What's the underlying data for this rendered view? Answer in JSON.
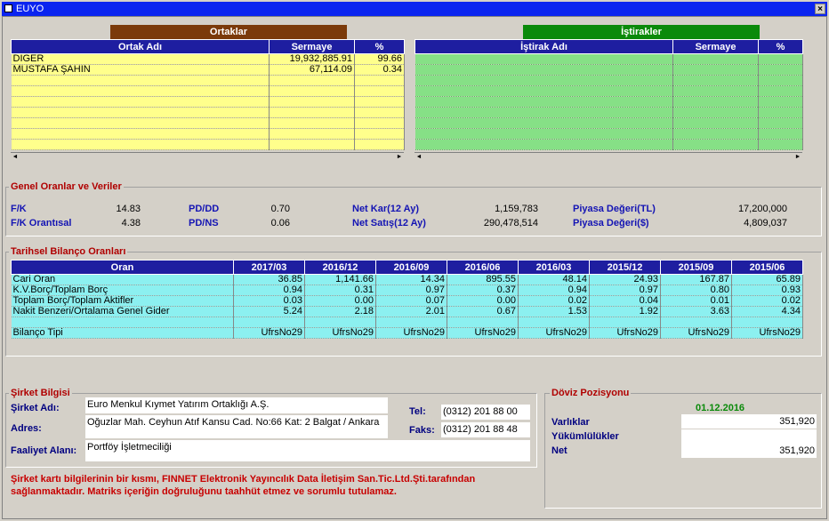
{
  "window": {
    "title": "EUYO"
  },
  "ortaklar": {
    "caption": "Ortaklar",
    "headers": [
      "Ortak Adı",
      "Sermaye",
      "%"
    ],
    "rows": [
      [
        "DİĞER",
        "19,932,885.91",
        "99.66"
      ],
      [
        "MUSTAFA ŞAHİN",
        "67,114.09",
        "0.34"
      ]
    ],
    "empty_rows": 7,
    "caption_color": "#7b3a0a"
  },
  "istirakler": {
    "caption": "İştirakler",
    "headers": [
      "İştirak Adı",
      "Sermaye",
      "%"
    ],
    "empty_rows": 9,
    "caption_color": "#0a8a0a"
  },
  "genel": {
    "title": "Genel Oranlar ve Veriler",
    "fk_label": "F/K",
    "fk_value": "14.83",
    "fko_label": "F/K Orantısal",
    "fko_value": "4.38",
    "pddd_label": "PD/DD",
    "pddd_value": "0.70",
    "pdns_label": "PD/NS",
    "pdns_value": "0.06",
    "netkar_label": "Net Kar(12 Ay)",
    "netkar_value": "1,159,783",
    "netsatis_label": "Net Satış(12 Ay)",
    "netsatis_value": "290,478,514",
    "pdtl_label": "Piyasa Değeri(TL)",
    "pdtl_value": "17,200,000",
    "pdusd_label": "Piyasa Değeri($)",
    "pdusd_value": "4,809,037"
  },
  "tarihsel": {
    "title": "Tarihsel Bilanço Oranları",
    "headers": [
      "Oran",
      "2017/03",
      "2016/12",
      "2016/09",
      "2016/06",
      "2016/03",
      "2015/12",
      "2015/09",
      "2015/06"
    ],
    "rows": [
      [
        "Cari Oran",
        "36.85",
        "1,141.66",
        "14.34",
        "895.55",
        "48.14",
        "24.93",
        "167.87",
        "65.89"
      ],
      [
        "K.V.Borç/Toplam Borç",
        "0.94",
        "0.31",
        "0.97",
        "0.37",
        "0.94",
        "0.97",
        "0.80",
        "0.93"
      ],
      [
        "Toplam Borç/Toplam Aktifler",
        "0.03",
        "0.00",
        "0.07",
        "0.00",
        "0.02",
        "0.04",
        "0.01",
        "0.02"
      ],
      [
        "Nakit Benzeri/Ortalama Genel Gider",
        "5.24",
        "2.18",
        "2.01",
        "0.67",
        "1.53",
        "1.92",
        "3.63",
        "4.34"
      ],
      [
        "",
        "",
        "",
        "",
        "",
        "",
        "",
        "",
        ""
      ],
      [
        "Bilanço Tipi",
        "UfrsNo29",
        "UfrsNo29",
        "UfrsNo29",
        "UfrsNo29",
        "UfrsNo29",
        "UfrsNo29",
        "UfrsNo29",
        "UfrsNo29"
      ]
    ]
  },
  "sirket": {
    "title": "Şirket Bilgisi",
    "ad_label": "Şirket Adı:",
    "ad_value": "Euro Menkul Kıymet Yatırım Ortaklığı A.Ş.",
    "adres_label": "Adres:",
    "adres_value": "Oğuzlar Mah. Ceyhun Atıf Kansu Cad. No:66 Kat: 2 Balgat / Ankara",
    "faaliyet_label": "Faaliyet Alanı:",
    "faaliyet_value": "Portföy İşletmeciliği",
    "tel_label": "Tel:",
    "tel_value": "(0312) 201 88 00",
    "faks_label": "Faks:",
    "faks_value": "(0312) 201 88 48"
  },
  "doviz": {
    "title": "Döviz Pozisyonu",
    "date": "01.12.2016",
    "varliklar_label": "Varlıklar",
    "varliklar_value": "351,920",
    "yukumluluk_label": "Yükümlülükler",
    "yukumluluk_value": "",
    "net_label": "Net",
    "net_value": "351,920"
  },
  "footer": {
    "line1": "Şirket kartı bilgilerinin bir kısmı, FINNET Elektronik Yayıncılık Data İletişim San.Tic.Ltd.Şti.tarafından",
    "line2": "sağlanmaktadır. Matriks içeriğin doğruluğunu taahhüt etmez ve sorumlu tutulamaz."
  }
}
